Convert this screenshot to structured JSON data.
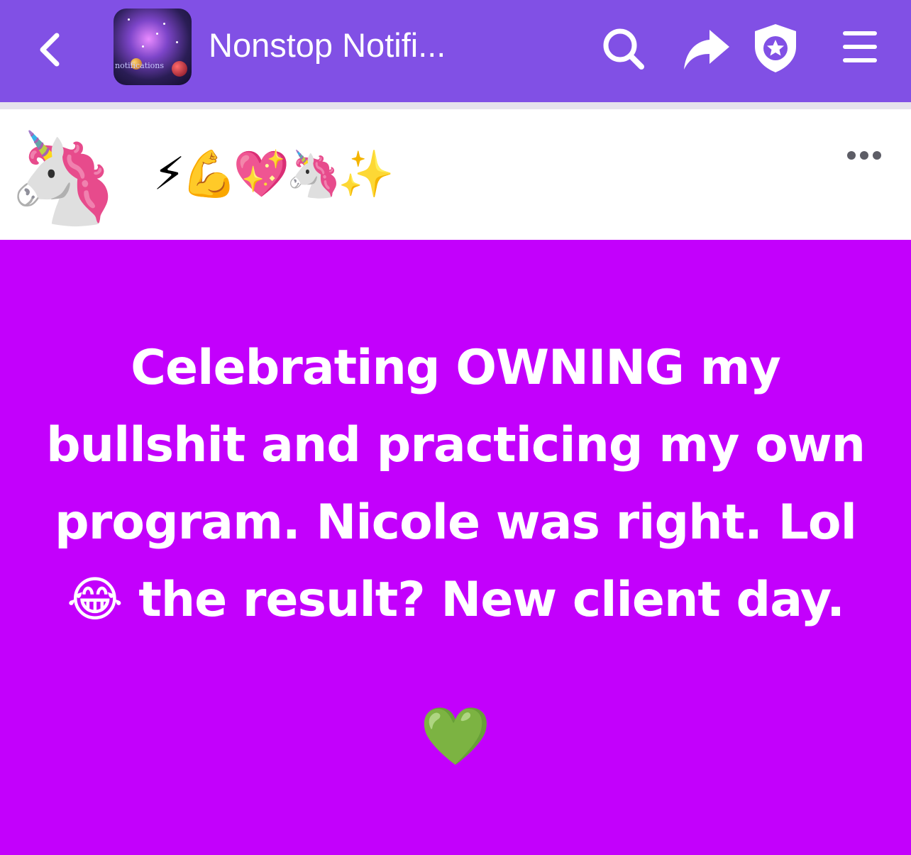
{
  "header": {
    "back_icon": "chevron-left-icon",
    "group_avatar_caption": "notifications",
    "title": "Nonstop Notifi...",
    "search_icon": "search-icon",
    "share_icon": "share-arrow-icon",
    "admin_icon": "shield-star-icon",
    "menu_icon": "hamburger-menu-icon",
    "bar_color": "#8150e5"
  },
  "post": {
    "author_avatar": "🦄",
    "author_name": "⚡💪💖🦄✨",
    "more_icon": "more-dots-icon",
    "text": "Celebrating OWNING my bullshit and practicing my own program. Nicole was right. Lol 😂 the result? New client day.",
    "closing_emoji": "💚",
    "background_color": "#c300fc"
  }
}
